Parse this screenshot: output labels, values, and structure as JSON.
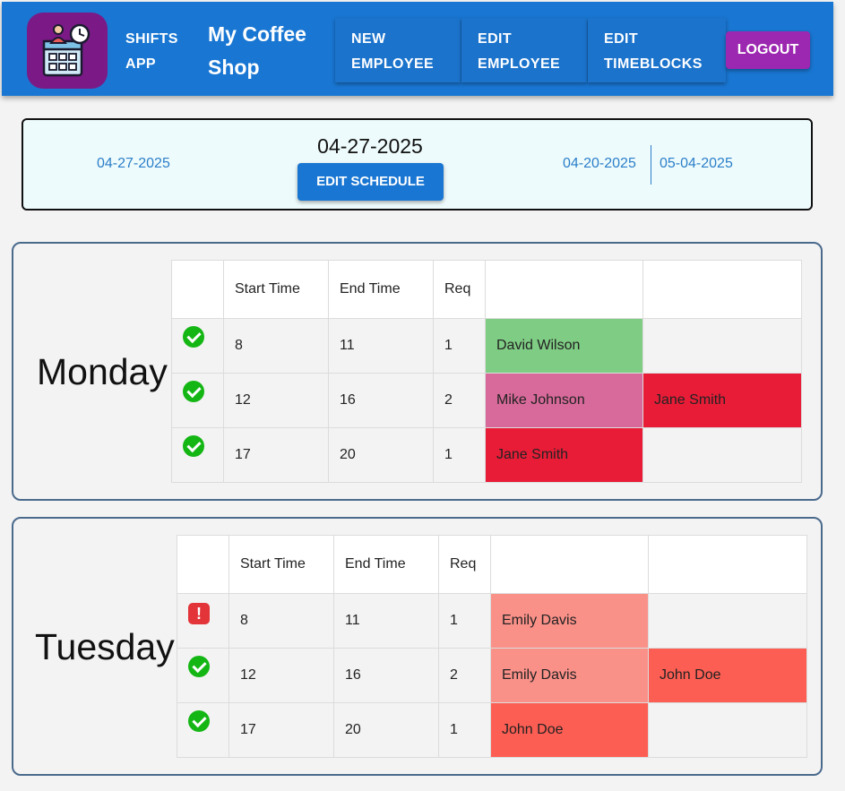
{
  "header": {
    "app_name_line1": "SHIFTS",
    "app_name_line2": "APP",
    "shop_name_line1": "My Coffee",
    "shop_name_line2": "Shop",
    "nav": [
      {
        "line1": "NEW",
        "line2": "EMPLOYEE"
      },
      {
        "line1": "EDIT",
        "line2": "EMPLOYEE"
      },
      {
        "line1": "EDIT",
        "line2": "TIMEBLOCKS"
      }
    ],
    "logout_label": "LOGOUT"
  },
  "schedule": {
    "left_date": "04-27-2025",
    "current_date": "04-27-2025",
    "edit_label": "EDIT SCHEDULE",
    "prev_date": "04-20-2025",
    "next_date": "05-04-2025"
  },
  "table_headers": [
    "",
    "Start Time",
    "End Time",
    "Req",
    "",
    ""
  ],
  "days": [
    {
      "name": "Monday",
      "rows": [
        {
          "status": "ok",
          "start": "8",
          "end": "11",
          "req": "1",
          "assignees": [
            {
              "name": "David Wilson",
              "color": "#7fcc84"
            },
            {
              "name": "",
              "color": ""
            }
          ]
        },
        {
          "status": "ok",
          "start": "12",
          "end": "16",
          "req": "2",
          "assignees": [
            {
              "name": "Mike Johnson",
              "color": "#d76a9a"
            },
            {
              "name": "Jane Smith",
              "color": "#e81c37"
            }
          ]
        },
        {
          "status": "ok",
          "start": "17",
          "end": "20",
          "req": "1",
          "assignees": [
            {
              "name": "Jane Smith",
              "color": "#e81c37"
            },
            {
              "name": "",
              "color": ""
            }
          ]
        }
      ]
    },
    {
      "name": "Tuesday",
      "rows": [
        {
          "status": "warning",
          "start": "8",
          "end": "11",
          "req": "1",
          "assignees": [
            {
              "name": "Emily Davis",
              "color": "#fa9189"
            },
            {
              "name": "",
              "color": ""
            }
          ]
        },
        {
          "status": "ok",
          "start": "12",
          "end": "16",
          "req": "2",
          "assignees": [
            {
              "name": "Emily Davis",
              "color": "#fa9189"
            },
            {
              "name": "John Doe",
              "color": "#fd5e53"
            }
          ]
        },
        {
          "status": "ok",
          "start": "17",
          "end": "20",
          "req": "1",
          "assignees": [
            {
              "name": "John Doe",
              "color": "#fd5e53"
            },
            {
              "name": "",
              "color": ""
            }
          ]
        }
      ]
    }
  ],
  "colors": {
    "appbar": "#1976d2",
    "logo_bg": "#7b1a86",
    "logout": "#9c27b0",
    "ok": "#14b614",
    "warning": "#e3343a"
  }
}
